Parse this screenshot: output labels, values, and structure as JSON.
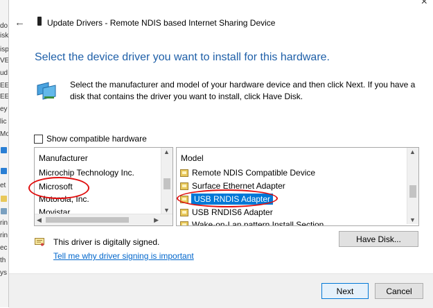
{
  "window": {
    "title": "Update Drivers - Remote NDIS based Internet Sharing Device",
    "close_glyph": "×",
    "back_glyph": "←"
  },
  "background_strip": {
    "fragments": [
      "do",
      "isk",
      "isp",
      "VE",
      "ud",
      "EE",
      "EE",
      "ey",
      "lic",
      "Mo",
      "et",
      "th",
      "rin",
      "rin",
      "ec",
      "ys"
    ]
  },
  "main": {
    "heading": "Select the device driver you want to install for this hardware.",
    "description": "Select the manufacturer and model of your hardware device and then click Next. If you have a disk that contains the driver you want to install, click Have Disk.",
    "show_compatible_label": "Show compatible hardware",
    "show_compatible_checked": false
  },
  "manufacturer_list": {
    "header": "Manufacturer",
    "items": [
      "Microchip Technology Inc.",
      "Microsoft",
      "Motorola, Inc.",
      "Movistar"
    ],
    "selected": "Microsoft"
  },
  "model_list": {
    "header": "Model",
    "items": [
      "Remote NDIS Compatible Device",
      "Surface Ethernet Adapter",
      "USB RNDIS Adapter",
      "USB RNDIS6 Adapter",
      "Wake-on-Lan pattern Install Section"
    ],
    "selected": "USB RNDIS Adapter"
  },
  "signing": {
    "status": "This driver is digitally signed.",
    "link": "Tell me why driver signing is important"
  },
  "buttons": {
    "have_disk": "Have Disk...",
    "next": "Next",
    "cancel": "Cancel"
  },
  "colors": {
    "accent": "#0078d7",
    "heading": "#1e5fa8",
    "link": "#0066cc",
    "annotation": "#e01010"
  },
  "icons": {
    "back": "back-arrow-icon",
    "device": "device-icon",
    "hardware": "hardware-monitor-icon",
    "driver_item": "driver-file-icon",
    "signed": "certificate-icon"
  }
}
